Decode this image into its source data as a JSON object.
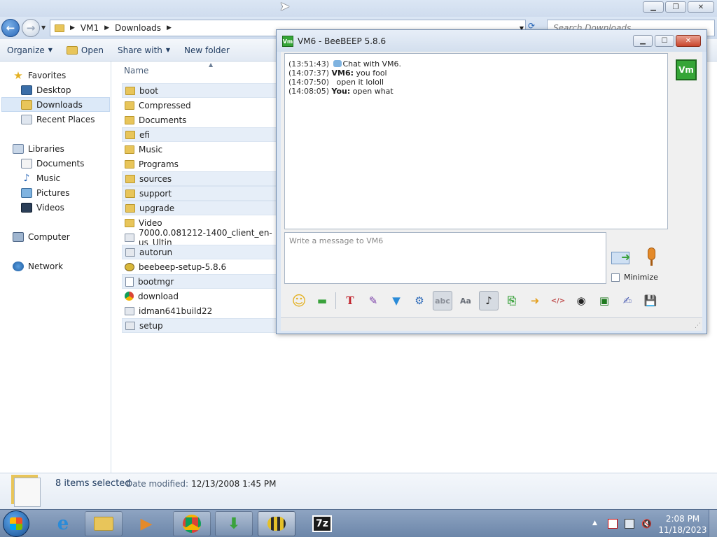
{
  "explorer": {
    "address": {
      "crumbs": [
        "VM1",
        "Downloads"
      ]
    },
    "search_placeholder": "Search Downloads",
    "toolbar": {
      "organize": "Organize",
      "open": "Open",
      "share_with": "Share with",
      "new_folder": "New folder"
    },
    "nav": {
      "favorites": "Favorites",
      "desktop": "Desktop",
      "downloads": "Downloads",
      "recent_places": "Recent Places",
      "libraries": "Libraries",
      "documents": "Documents",
      "music": "Music",
      "pictures": "Pictures",
      "videos": "Videos",
      "computer": "Computer",
      "network": "Network"
    },
    "column_name": "Name",
    "files": [
      {
        "name": "boot",
        "type": "folder",
        "selected": true
      },
      {
        "name": "Compressed",
        "type": "folder",
        "selected": false
      },
      {
        "name": "Documents",
        "type": "folder",
        "selected": false
      },
      {
        "name": "efi",
        "type": "folder",
        "selected": true
      },
      {
        "name": "Music",
        "type": "folder",
        "selected": false
      },
      {
        "name": "Programs",
        "type": "folder",
        "selected": false
      },
      {
        "name": "sources",
        "type": "folder",
        "selected": true
      },
      {
        "name": "support",
        "type": "folder",
        "selected": true
      },
      {
        "name": "upgrade",
        "type": "folder",
        "selected": true
      },
      {
        "name": "Video",
        "type": "folder",
        "selected": false
      },
      {
        "name": "7000.0.081212-1400_client_en-us_Ultin",
        "type": "exe",
        "selected": false
      },
      {
        "name": "autorun",
        "type": "exe",
        "selected": true
      },
      {
        "name": "beebeep-setup-5.8.6",
        "type": "bee",
        "selected": false
      },
      {
        "name": "bootmgr",
        "type": "doc",
        "selected": true
      },
      {
        "name": "download",
        "type": "chrome",
        "selected": false
      },
      {
        "name": "idman641build22",
        "type": "exe",
        "selected": false
      },
      {
        "name": "setup",
        "type": "exe",
        "selected": true
      }
    ],
    "details": {
      "selection_count": "8 items selected",
      "date_label": "Date modified:",
      "date_value": "12/13/2008 1:45 PM"
    }
  },
  "chat": {
    "title": "VM6 - BeeBEEP 5.8.6",
    "app_icon_text": "Vm",
    "avatar_text": "Vm",
    "messages": [
      {
        "time": "(13:51:43)",
        "author": "",
        "text": "Chat with VM6.",
        "system": true
      },
      {
        "time": "(14:07:37)",
        "author": "VM6:",
        "text": "you fool",
        "system": false
      },
      {
        "time": "(14:07:50)",
        "author": "",
        "text": "open it lololl",
        "system": false
      },
      {
        "time": "(14:08:05)",
        "author": "You:",
        "text": "open what",
        "system": false
      }
    ],
    "input_placeholder": "Write a message to VM6",
    "minimize_label": "Minimize"
  },
  "taskbar": {
    "clock_time": "2:08 PM",
    "clock_date": "11/18/2023",
    "apps": [
      "internet-explorer",
      "windows-explorer",
      "media-player",
      "chrome",
      "internet-download-manager",
      "beebeep",
      "7zip"
    ]
  },
  "colors": {
    "accent": "#2a68b8",
    "beebeep_green": "#35a537",
    "selection": "#e6eef8"
  }
}
